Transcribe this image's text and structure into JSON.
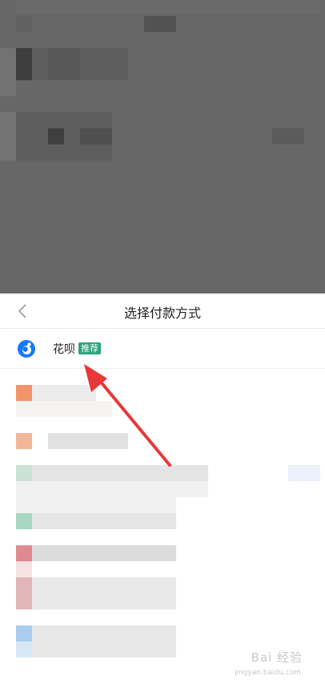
{
  "sheet": {
    "title": "选择付款方式",
    "back_icon": "chevron-left-icon"
  },
  "payment_methods": [
    {
      "label": "花呗",
      "badge": "推荐",
      "icon": "huabei-logo-icon"
    }
  ],
  "colors": {
    "accent": "#1677ff",
    "badge": "#2aa37a",
    "arrow": "#e8383a",
    "overlay": "#676767"
  },
  "watermark": {
    "text": "Bai 经验",
    "sub": "jingyan.baidu.com"
  }
}
